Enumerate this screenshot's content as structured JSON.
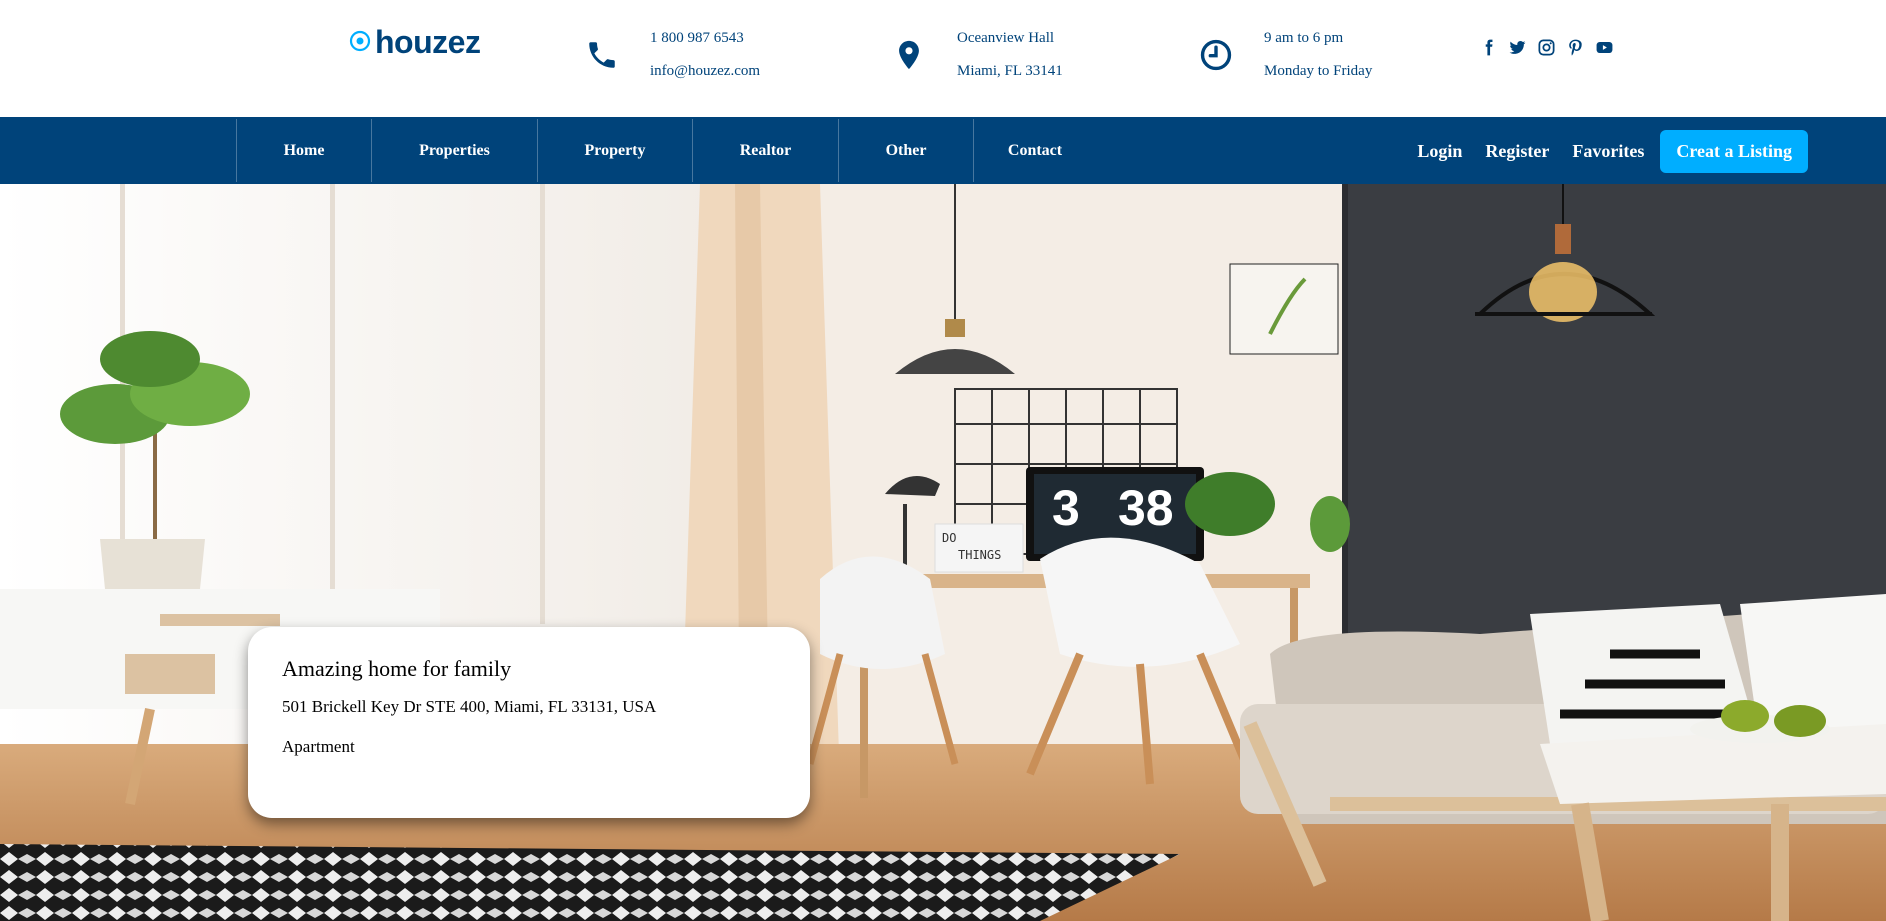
{
  "brand": {
    "name": "houzez",
    "color": "#00437a",
    "accent": "#00aeff"
  },
  "contact": {
    "phone": {
      "icon": "phone-icon",
      "line1": "1 800 987 6543",
      "line2": "info@houzez.com"
    },
    "location": {
      "icon": "map-pin-icon",
      "line1": "Oceanview Hall",
      "line2": "Miami, FL 33141"
    },
    "hours": {
      "icon": "clock-icon",
      "line1": "9 am to 6 pm",
      "line2": "Monday to Friday"
    }
  },
  "social": [
    "facebook-icon",
    "twitter-icon",
    "instagram-icon",
    "pinterest-icon",
    "youtube-icon"
  ],
  "nav": {
    "items": [
      {
        "label": "Home"
      },
      {
        "label": "Properties"
      },
      {
        "label": "Property"
      },
      {
        "label": "Realtor"
      },
      {
        "label": "Other"
      },
      {
        "label": "Contact"
      }
    ],
    "login": "Login",
    "register": "Register",
    "favorites": "Favorites",
    "cta": "Creat a Listing",
    "background": "#00437a"
  },
  "hero": {
    "card": {
      "title": "Amazing home for family",
      "address": "501 Brickell Key Dr STE 400, Miami, FL 33131, USA",
      "type": "Apartment"
    },
    "clock_display": {
      "hours": "3",
      "minutes": "38"
    },
    "sign_text": {
      "line1": "DO",
      "line2": "THINGS"
    }
  }
}
